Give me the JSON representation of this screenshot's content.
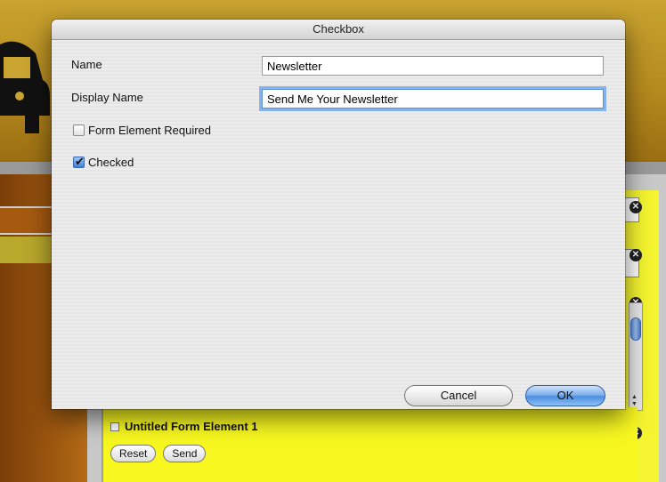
{
  "dialog": {
    "title": "Checkbox",
    "name_label": "Name",
    "name_value": "Newsletter",
    "display_name_label": "Display Name",
    "display_name_value": "Send Me Your Newsletter",
    "required_label": "Form Element Required",
    "required_checked": false,
    "checked_label": "Checked",
    "checked_checked": true,
    "cancel_label": "Cancel",
    "ok_label": "OK"
  },
  "background": {
    "form_element_label": "Untitled Form Element 1",
    "reset_label": "Reset",
    "send_label": "Send",
    "close_glyph": "✕",
    "colors": {
      "yellow": "#f8f820",
      "brown": "#9a540e",
      "gold": "#c9a430"
    }
  },
  "icons": [
    "car-icon",
    "close-icon",
    "checkmark-icon"
  ]
}
